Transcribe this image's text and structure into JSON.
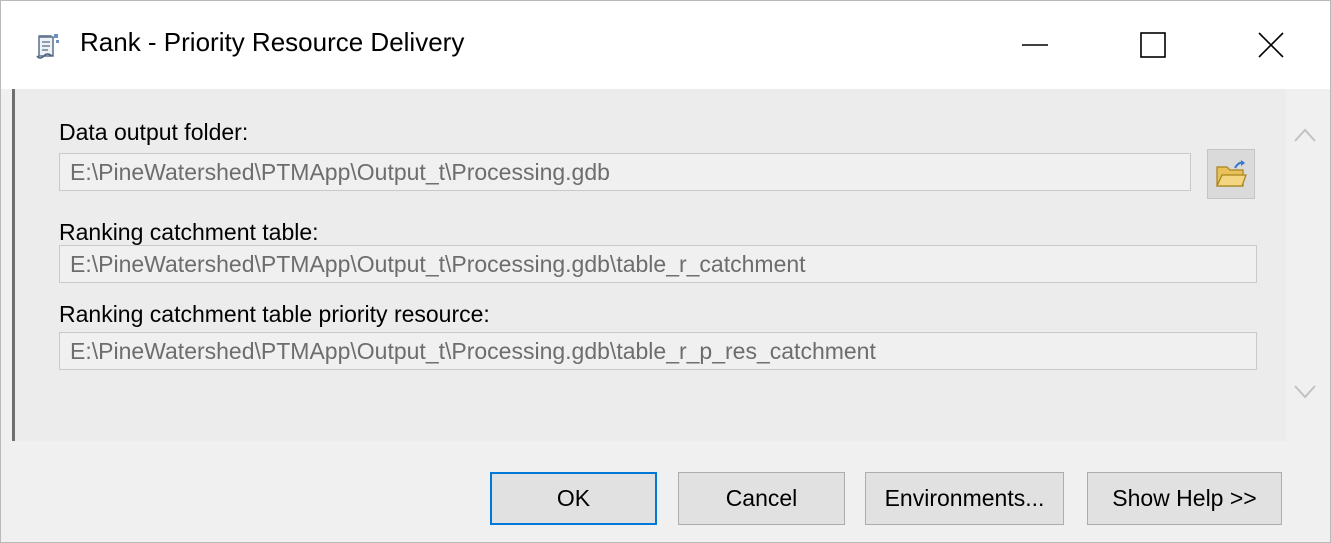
{
  "window": {
    "title": "Rank - Priority Resource Delivery",
    "app_icon": "tool-script-icon",
    "controls": [
      "minimize-icon",
      "maximize-icon",
      "close-icon"
    ]
  },
  "form": {
    "data_output_folder": {
      "label": "Data output folder:",
      "value": "E:\\PineWatershed\\PTMApp\\Output_t\\Processing.gdb",
      "browse_icon": "folder-open-icon"
    },
    "ranking_catchment_table": {
      "label": "Ranking catchment table:",
      "value": "E:\\PineWatershed\\PTMApp\\Output_t\\Processing.gdb\\table_r_catchment"
    },
    "ranking_catchment_table_priority_resource": {
      "label": "Ranking catchment table priority resource:",
      "value": "E:\\PineWatershed\\PTMApp\\Output_t\\Processing.gdb\\table_r_p_res_catchment"
    }
  },
  "scrollbar": {
    "up_icon": "chevron-up-icon",
    "down_icon": "chevron-down-icon"
  },
  "buttons": {
    "ok": "OK",
    "cancel": "Cancel",
    "environments": "Environments...",
    "show_help": "Show Help >>"
  },
  "colors": {
    "accent": "#0078d7",
    "field_text": "#6d6d6d",
    "panel": "#ececec"
  }
}
